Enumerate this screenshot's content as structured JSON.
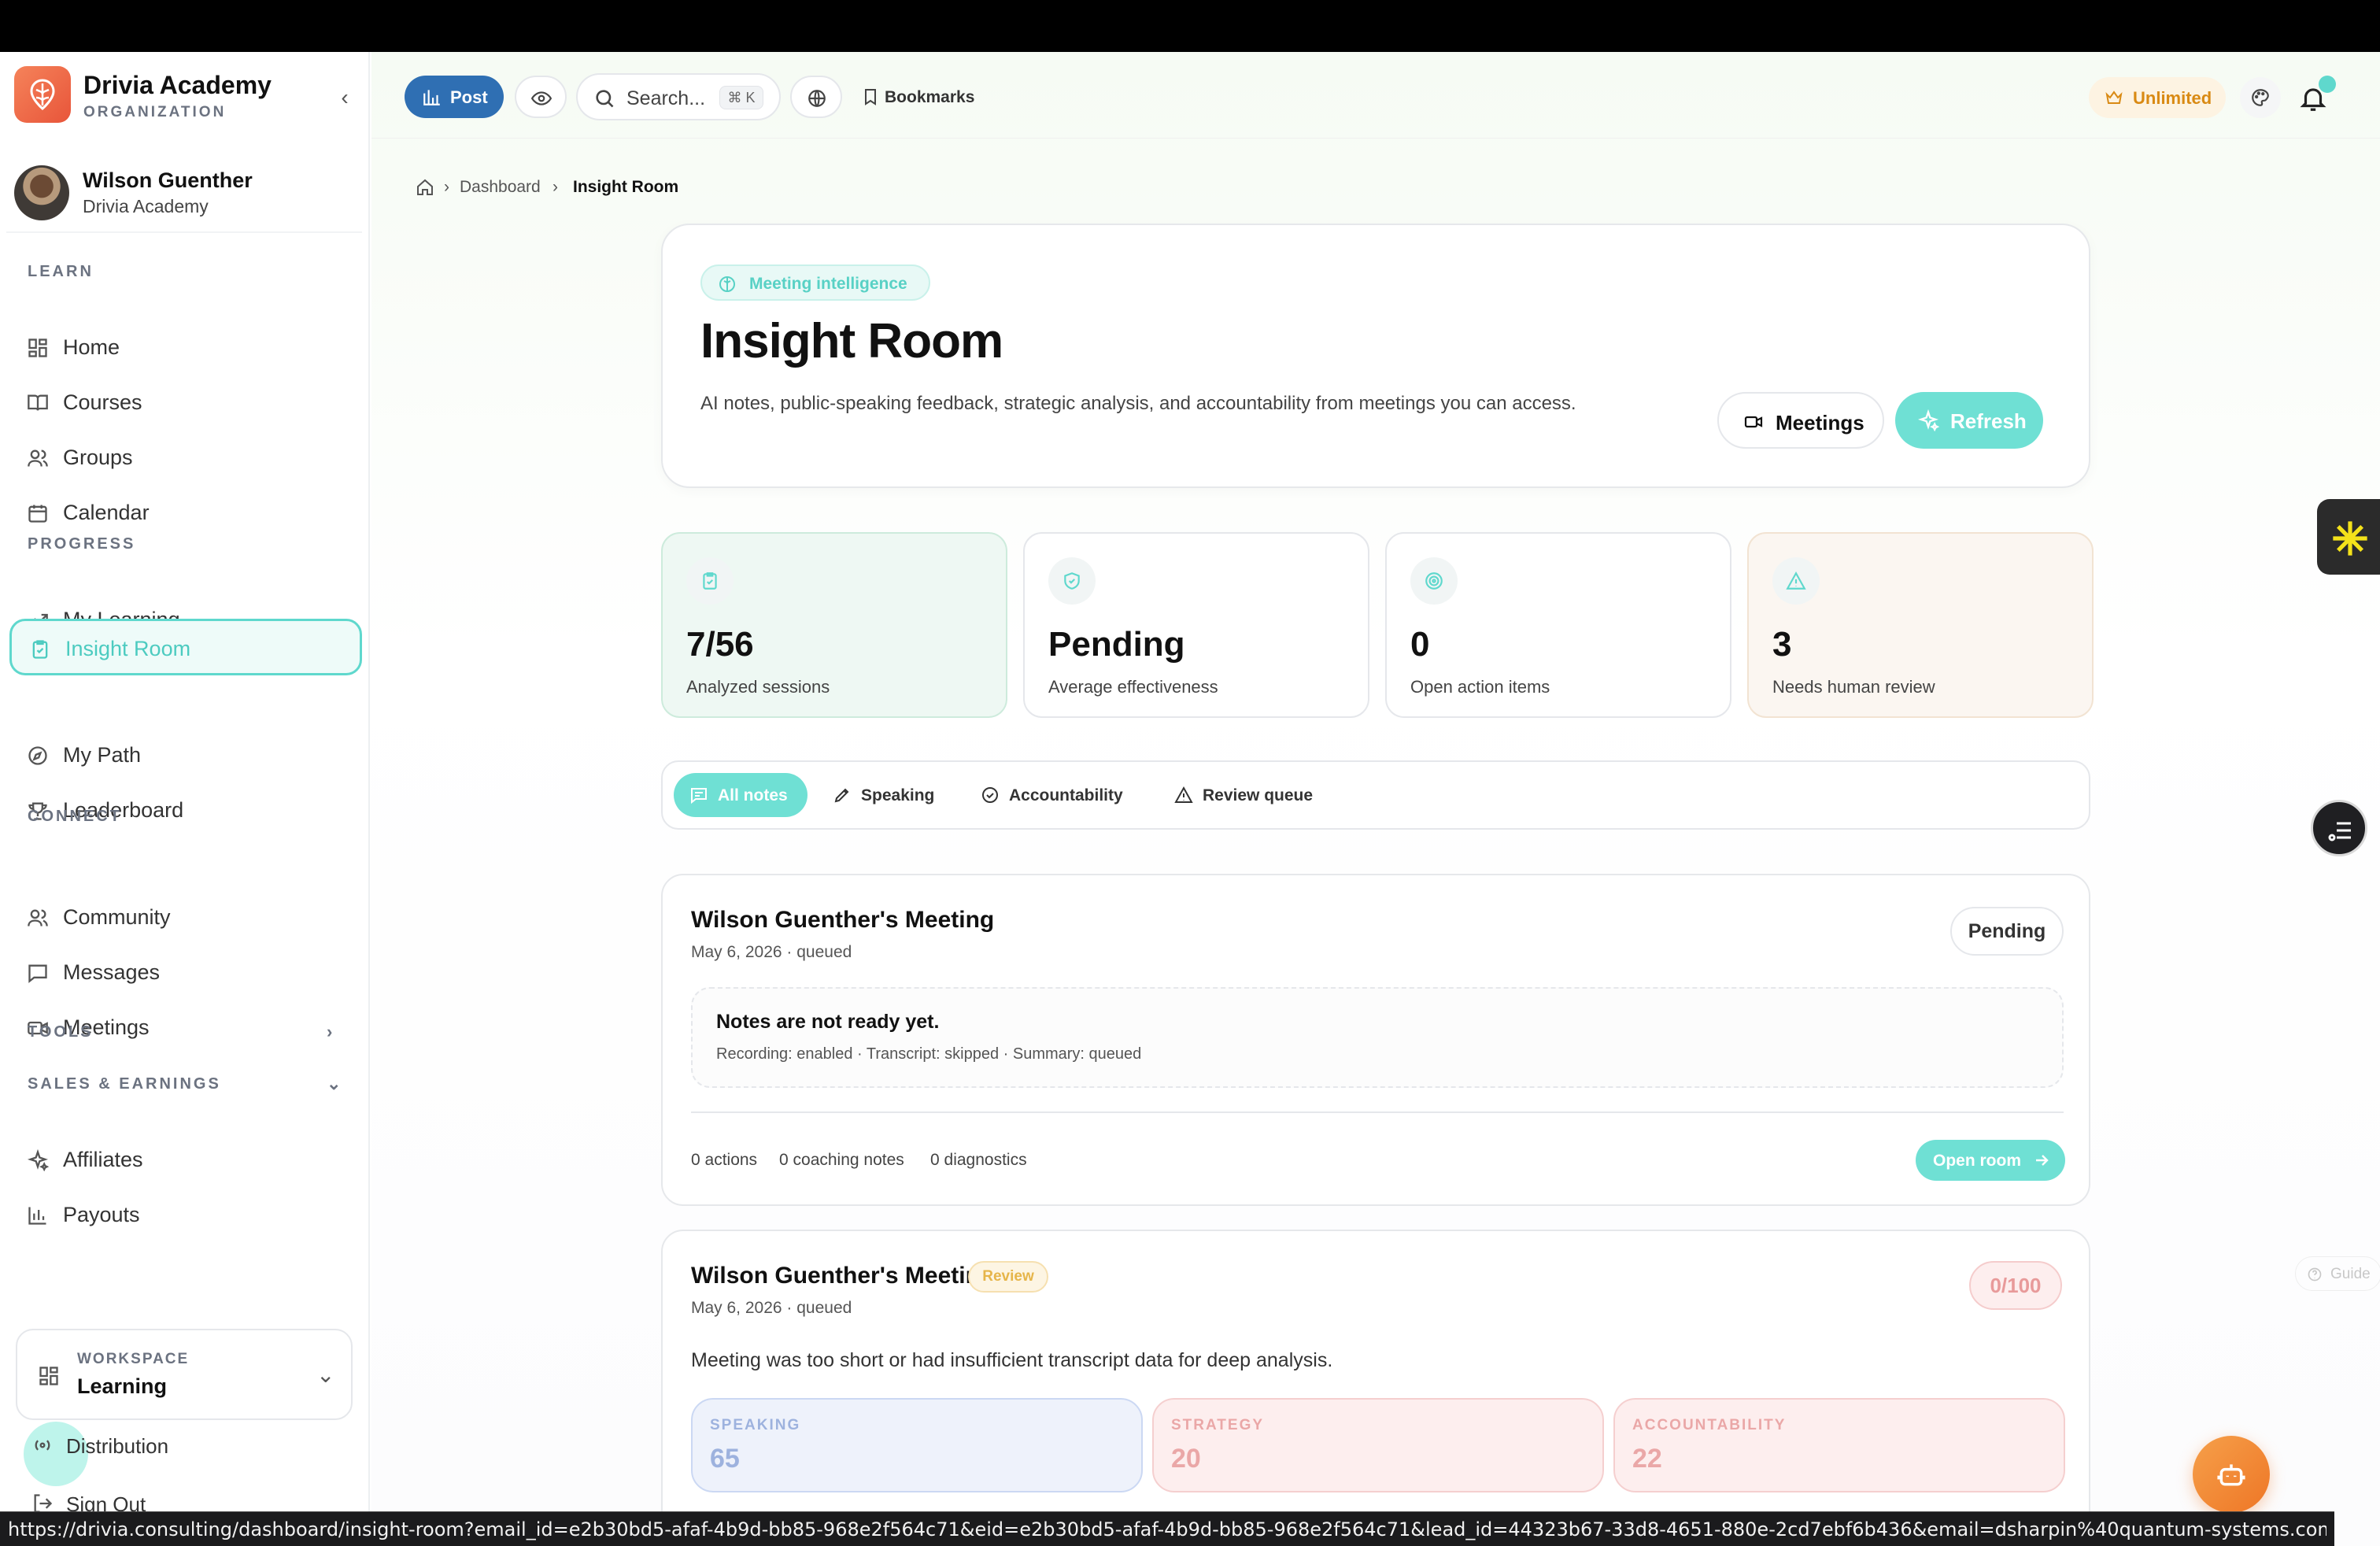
{
  "brand": {
    "name": "Drivia Academy",
    "subtitle": "ORGANIZATION"
  },
  "user": {
    "name": "Wilson Guenther",
    "org": "Drivia Academy"
  },
  "sidebar": {
    "sections": {
      "learn": "LEARN",
      "progress": "PROGRESS",
      "connect": "CONNECT",
      "tools": "TOOLS",
      "sales": "SALES & EARNINGS"
    },
    "items": {
      "home": "Home",
      "courses": "Courses",
      "groups": "Groups",
      "calendar": "Calendar",
      "my_learning": "My Learning",
      "insight_room": "Insight Room",
      "my_path": "My Path",
      "leaderboard": "Leaderboard",
      "community": "Community",
      "messages": "Messages",
      "meetings": "Meetings",
      "affiliates": "Affiliates",
      "payouts": "Payouts"
    },
    "active": "insight_room",
    "workspace": {
      "label": "WORKSPACE",
      "value": "Learning"
    },
    "distribution": "Distribution",
    "sign_out": "Sign Out"
  },
  "header": {
    "post_label": "Post",
    "search_placeholder": "Search...",
    "search_shortcut": "⌘ K",
    "bookmarks_label": "Bookmarks",
    "plan_label": "Unlimited"
  },
  "breadcrumb": {
    "dashboard": "Dashboard",
    "current": "Insight Room"
  },
  "hero": {
    "chip": "Meeting intelligence",
    "title": "Insight Room",
    "description": "AI notes, public-speaking feedback, strategic analysis, and accountability from meetings you can access.",
    "meetings_button": "Meetings",
    "refresh_button": "Refresh"
  },
  "stats": [
    {
      "value": "7/56",
      "label": "Analyzed sessions"
    },
    {
      "value": "Pending",
      "label": "Average effectiveness"
    },
    {
      "value": "0",
      "label": "Open action items"
    },
    {
      "value": "3",
      "label": "Needs human review"
    }
  ],
  "tabs": {
    "all": "All notes",
    "speaking": "Speaking",
    "accountability": "Accountability",
    "review": "Review queue"
  },
  "meetings": [
    {
      "title": "Wilson Guenther's Meeting",
      "meta": "May 6, 2026 · queued",
      "status": "Pending",
      "notes_title": "Notes are not ready yet.",
      "notes_sub": "Recording: enabled · Transcript: skipped · Summary: queued",
      "actions": "0 actions",
      "coaching": "0 coaching notes",
      "diagnostics": "0 diagnostics",
      "open_label": "Open room"
    },
    {
      "title": "Wilson Guenther's Meeting",
      "badge": "Review",
      "meta": "May 6, 2026 · queued",
      "score": "0/100",
      "description": "Meeting was too short or had insufficient transcript data for deep analysis.",
      "metrics": [
        {
          "label": "SPEAKING",
          "value": "65"
        },
        {
          "label": "STRATEGY",
          "value": "20"
        },
        {
          "label": "ACCOUNTABILITY",
          "value": "22"
        }
      ]
    }
  ],
  "guide_label": "Guide",
  "status_url": "https://drivia.consulting/dashboard/insight-room?email_id=e2b30bd5-afaf-4b9d-bb85-968e2f564c71&eid=e2b30bd5-afaf-4b9d-bb85-968e2f564c71&lead_id=44323b67-33d8-4651-880e-2cd7ebf6b436&email=dsharpin%40quantum-systems.com&nam..."
}
